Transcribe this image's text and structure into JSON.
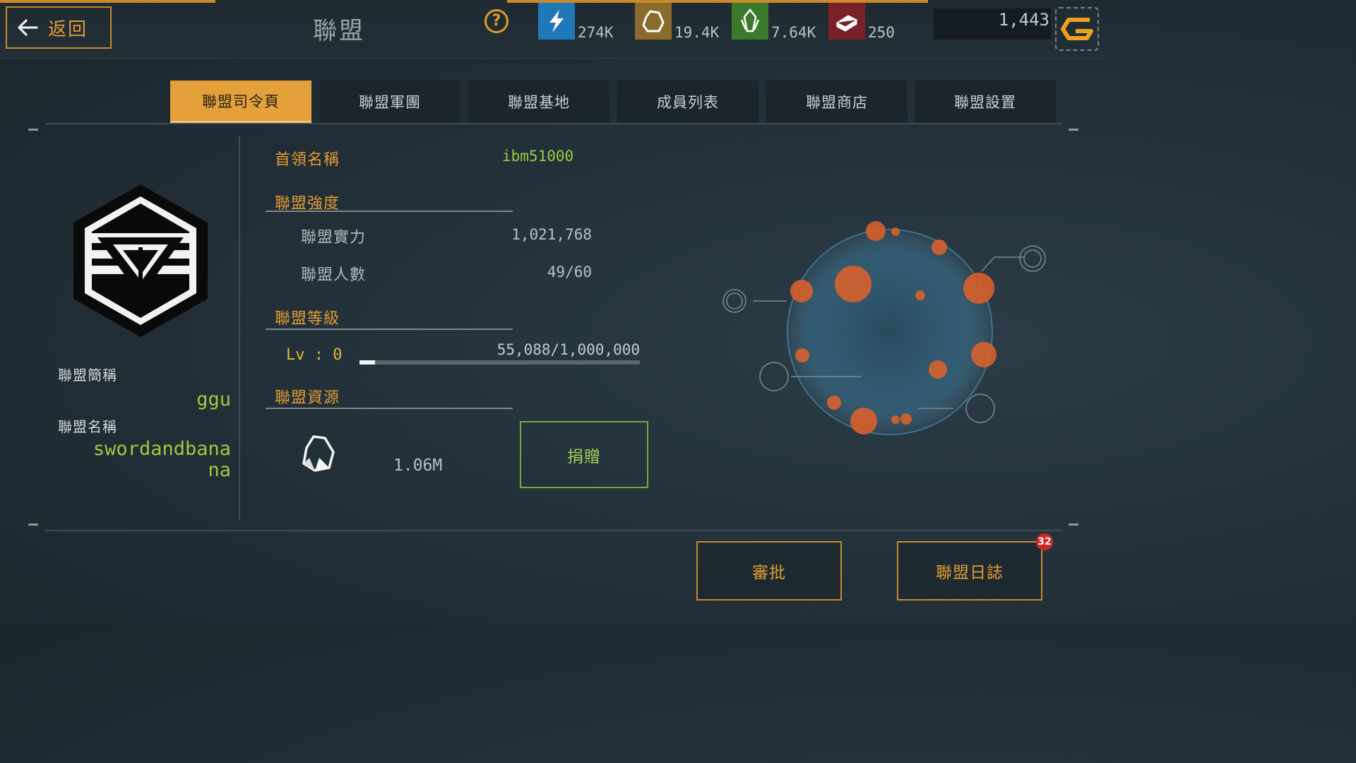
{
  "header": {
    "back_label": "返回",
    "title": "聯盟",
    "resources": [
      {
        "icon": "energy-icon",
        "value": "274K",
        "color": "#1f78b8"
      },
      {
        "icon": "ore-icon",
        "value": "19.4K",
        "color": "#8a6b2c"
      },
      {
        "icon": "crystal-icon",
        "value": "7.64K",
        "color": "#3a7a2a"
      },
      {
        "icon": "alloy-icon",
        "value": "250",
        "color": "#7a2028"
      }
    ],
    "gold": "1,443"
  },
  "tabs": [
    {
      "label": "聯盟司令頁",
      "active": true
    },
    {
      "label": "聯盟軍團",
      "active": false
    },
    {
      "label": "聯盟基地",
      "active": false
    },
    {
      "label": "成員列表",
      "active": false
    },
    {
      "label": "聯盟商店",
      "active": false
    },
    {
      "label": "聯盟設置",
      "active": false
    }
  ],
  "alliance": {
    "short_name_label": "聯盟簡稱",
    "short_name": "ggu",
    "name_label": "聯盟名稱",
    "name_line1": "swordandbana",
    "name_line2": "na"
  },
  "info": {
    "leader_label": "首領名稱",
    "leader": "ibm51000",
    "strength_header": "聯盟強度",
    "power_label": "聯盟實力",
    "power": "1,021,768",
    "members_label": "聯盟人數",
    "members": "49/60",
    "level_header": "聯盟等級",
    "level": "Lv : 0",
    "exp_text": "55,088/1,000,000",
    "exp_fraction": 0.055,
    "resource_header": "聯盟資源",
    "resource_value": "1.06M",
    "donate_label": "捐贈"
  },
  "bottom": {
    "approve_label": "審批",
    "log_label": "聯盟日誌",
    "log_badge": "32"
  },
  "colors": {
    "accent": "#e39b34",
    "green": "#9dcc3d",
    "badge": "#d42323"
  }
}
